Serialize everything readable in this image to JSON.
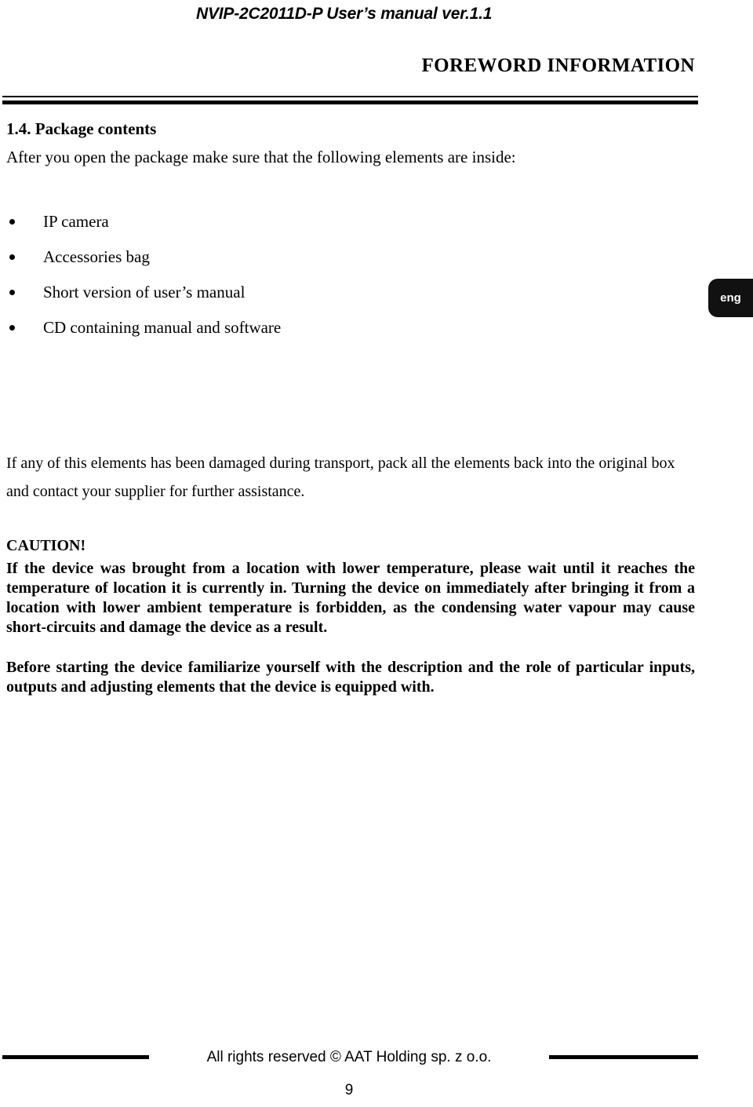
{
  "header": {
    "running_title": "NVIP-2C2011D-P User’s manual ver.1.1",
    "chapter_title": "FOREWORD INFORMATION"
  },
  "language_tab": {
    "label": "eng",
    "background_color": "#111111",
    "text_color": "#ffffff"
  },
  "body": {
    "section_heading": "1.4. Package contents",
    "intro_line": "After you open the package make sure that the following elements are inside:",
    "bullets": [
      "IP camera",
      "Accessories bag",
      "Short version of user’s manual",
      "CD containing manual and software"
    ],
    "paragraph_transport": "If any of this elements has been damaged during transport, pack all the elements back into the original box and contact your supplier for further assistance.",
    "caution_label": "CAUTION!",
    "paragraph_caution": "If the device was brought from a location with lower temperature, please wait until it reaches the temperature of location it is currently in. Turning the device on immediately after bringing it from a location with lower ambient temperature is forbidden, as the condensing water vapour may cause short-circuits and damage the device as a result.",
    "paragraph_before_start": "Before starting the device familiarize yourself with the description and the role of particular inputs, outputs and adjusting elements that the device is equipped with."
  },
  "footer": {
    "copyright": "All rights reserved © AAT Holding sp. z o.o.",
    "page_number": "9"
  }
}
